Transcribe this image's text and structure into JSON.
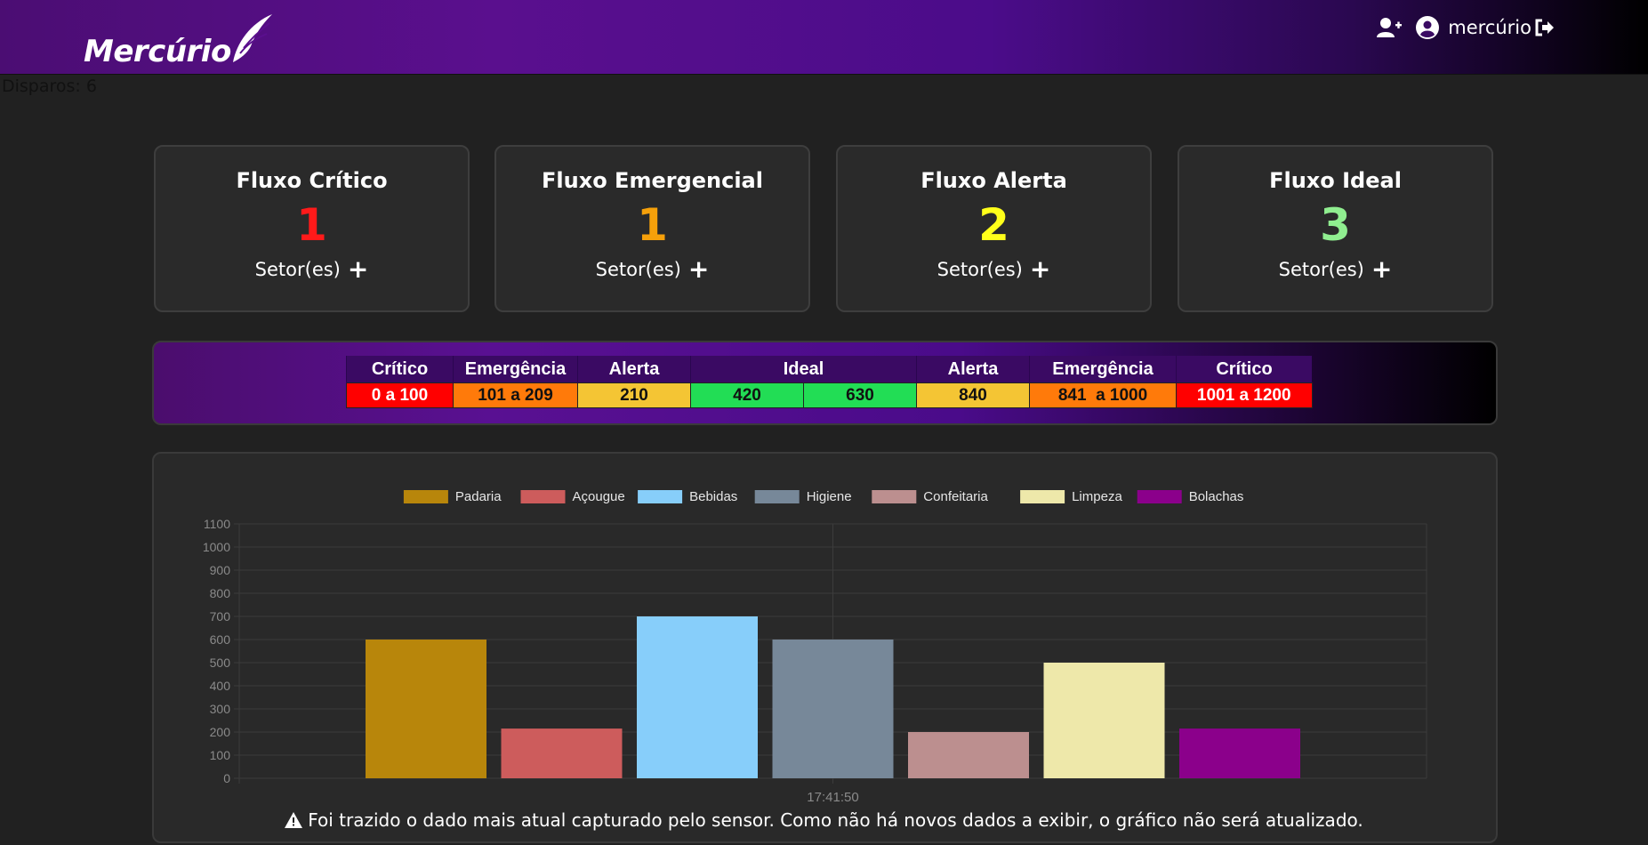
{
  "app": {
    "brand": "Mercúrio",
    "user_name": "mercúrio"
  },
  "icons": {
    "add_user": "user-plus-icon",
    "account": "user-circle-icon",
    "logout": "sign-out-icon",
    "warning": "warning-triangle-icon",
    "plus": "plus-icon"
  },
  "disparos_label": "Disparos: 6",
  "cards": [
    {
      "title": "Fluxo Crítico",
      "count": "1",
      "color": "#ff1a1a",
      "footer": "Setor(es)"
    },
    {
      "title": "Fluxo Emergencial",
      "count": "1",
      "color": "#f5a00a",
      "footer": "Setor(es)"
    },
    {
      "title": "Fluxo Alerta",
      "count": "2",
      "color": "#ffff1a",
      "footer": "Setor(es)"
    },
    {
      "title": "Fluxo Ideal",
      "count": "3",
      "color": "#90ee90",
      "footer": "Setor(es)"
    }
  ],
  "scale": {
    "headers": [
      "Crítico",
      "Emergência",
      "Alerta",
      "Ideal",
      "Alerta",
      "Emergência",
      "Crítico"
    ],
    "values": [
      {
        "text": "0 a 100",
        "color": "#ff0000",
        "text_color": "#ffffff"
      },
      {
        "text": "101 a 209",
        "color": "#ff7a0a",
        "text_color": "#111111"
      },
      {
        "text": "210",
        "color": "#f4c534",
        "text_color": "#111111"
      },
      {
        "text": "420",
        "color": "#22dd55",
        "text_color": "#111111"
      },
      {
        "text": "630",
        "color": "#22dd55",
        "text_color": "#111111"
      },
      {
        "text": "840",
        "color": "#f4c534",
        "text_color": "#111111"
      },
      {
        "text": "841  a 1000",
        "color": "#ff7a0a",
        "text_color": "#111111"
      },
      {
        "text": "1001 a 1200",
        "color": "#ff0000",
        "text_color": "#ffffff"
      }
    ]
  },
  "chart_data": {
    "type": "bar",
    "x_label": "17:41:50",
    "ylim": [
      0,
      1100
    ],
    "yticks": [
      0,
      100,
      200,
      300,
      400,
      500,
      600,
      700,
      800,
      900,
      1000,
      1100
    ],
    "grid": true,
    "legend_position": "top",
    "series": [
      {
        "name": "Padaria",
        "value": 600,
        "color": "#b8860b"
      },
      {
        "name": "Açougue",
        "value": 215,
        "color": "#cd5c5c"
      },
      {
        "name": "Bebidas",
        "value": 700,
        "color": "#87cefa"
      },
      {
        "name": "Higiene",
        "value": 600,
        "color": "#778899"
      },
      {
        "name": "Confeitaria",
        "value": 200,
        "color": "#bc8f8f"
      },
      {
        "name": "Limpeza",
        "value": 500,
        "color": "#eee8aa"
      },
      {
        "name": "Bolachas",
        "value": 215,
        "color": "#8b008b"
      }
    ]
  },
  "warning_text": "Foi trazido o dado mais atual capturado pelo sensor. Como não há novos dados a exibir, o gráfico não será atualizado."
}
